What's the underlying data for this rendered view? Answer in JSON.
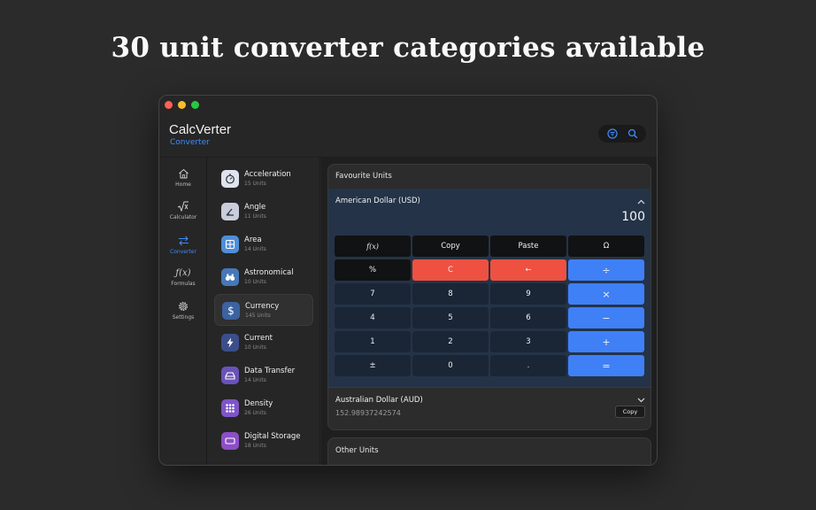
{
  "headline": "30 unit converter categories available",
  "app": {
    "title": "CalcVerter",
    "subtitle": "Converter",
    "accent_color": "#3d8bff",
    "header_tools": [
      "filter-icon",
      "search-icon"
    ]
  },
  "nav": [
    {
      "label": "Home",
      "icon": "home-icon"
    },
    {
      "label": "Calculator",
      "icon": "sqrt-x-icon"
    },
    {
      "label": "Converter",
      "icon": "swap-arrows-icon",
      "active": true
    },
    {
      "label": "Formulas",
      "icon": "fx-icon"
    },
    {
      "label": "Settings",
      "icon": "gear-icon"
    }
  ],
  "categories": [
    {
      "name": "Acceleration",
      "count": "15 Units",
      "icon": "stopwatch-icon",
      "color": "#dfe3ee"
    },
    {
      "name": "Angle",
      "count": "11 Units",
      "icon": "angle-icon",
      "color": "#c9cddb"
    },
    {
      "name": "Area",
      "count": "14 Units",
      "icon": "area-grid-icon",
      "color": "#4f8ed8"
    },
    {
      "name": "Astronomical",
      "count": "10 Units",
      "icon": "binoculars-icon",
      "color": "#4678b8"
    },
    {
      "name": "Currency",
      "count": "145 Units",
      "icon": "dollar-icon",
      "color": "#3c62a0",
      "active": true
    },
    {
      "name": "Current",
      "count": "10 Units",
      "icon": "bolt-icon",
      "color": "#3c4e8a"
    },
    {
      "name": "Data Transfer",
      "count": "14 Units",
      "icon": "drive-icon",
      "color": "#6a52b8"
    },
    {
      "name": "Density",
      "count": "26 Units",
      "icon": "dots-grid-icon",
      "color": "#7e55c8"
    },
    {
      "name": "Digital Storage",
      "count": "18 Units",
      "icon": "storage-icon",
      "color": "#8c4fc6"
    }
  ],
  "favourite": {
    "title": "Favourite Units",
    "active_unit": "American Dollar (USD)",
    "active_value": "100",
    "second_unit": "Australian Dollar (AUD)",
    "second_value": "152.98937242574",
    "copy_label": "Copy"
  },
  "keypad": {
    "row1": [
      "f(x)",
      "Copy",
      "Paste",
      "Ω"
    ],
    "row2": [
      "%",
      "C",
      "←",
      "÷"
    ],
    "row3": [
      "7",
      "8",
      "9",
      "×"
    ],
    "row4": [
      "4",
      "5",
      "6",
      "−"
    ],
    "row5": [
      "1",
      "2",
      "3",
      "+"
    ],
    "row6": [
      "±",
      "0",
      ".",
      "="
    ]
  },
  "other": {
    "title": "Other Units"
  }
}
